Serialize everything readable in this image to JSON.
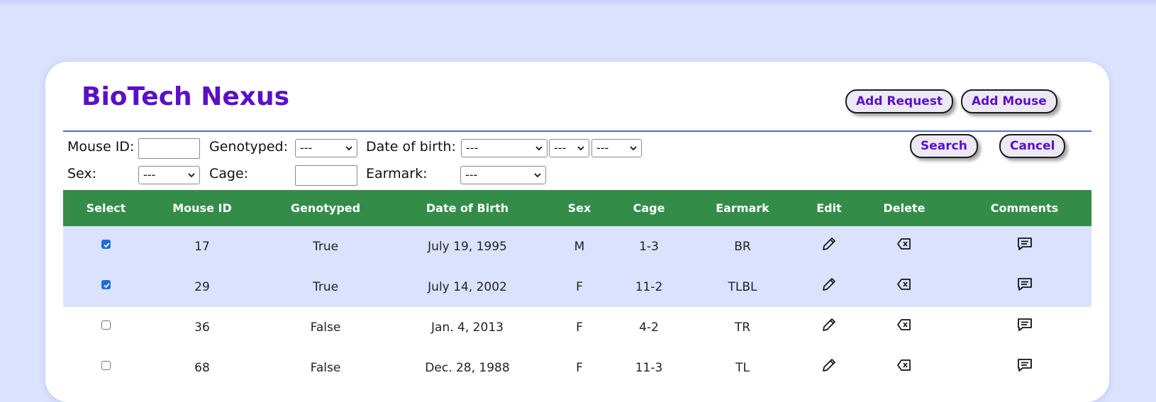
{
  "app": {
    "title": "BioTech Nexus"
  },
  "header": {
    "add_request": "Add Request",
    "add_mouse": "Add Mouse"
  },
  "filters": {
    "mouse_id_label": "Mouse ID:",
    "genotyped_label": "Genotyped:",
    "genotyped_value": "---",
    "dob_label": "Date of birth:",
    "dob_month_value": "---",
    "dob_day_value": "---",
    "dob_year_value": "---",
    "sex_label": "Sex:",
    "sex_value": "---",
    "cage_label": "Cage:",
    "earmark_label": "Earmark:",
    "earmark_value": "---",
    "search": "Search",
    "cancel": "Cancel"
  },
  "table": {
    "columns": [
      "Select",
      "Mouse ID",
      "Genotyped",
      "Date of Birth",
      "Sex",
      "Cage",
      "Earmark",
      "Edit",
      "Delete",
      "Comments"
    ],
    "rows": [
      {
        "selected": true,
        "id": "17",
        "genotyped": "True",
        "dob": "July 19, 1995",
        "sex": "M",
        "cage": "1-3",
        "earmark": "BR"
      },
      {
        "selected": true,
        "id": "29",
        "genotyped": "True",
        "dob": "July 14, 2002",
        "sex": "F",
        "cage": "11-2",
        "earmark": "TLBL"
      },
      {
        "selected": false,
        "id": "36",
        "genotyped": "False",
        "dob": "Jan. 4, 2013",
        "sex": "F",
        "cage": "4-2",
        "earmark": "TR"
      },
      {
        "selected": false,
        "id": "68",
        "genotyped": "False",
        "dob": "Dec. 28, 1988",
        "sex": "F",
        "cage": "11-3",
        "earmark": "TL"
      }
    ],
    "icons": {
      "edit": "pencil-icon",
      "delete": "backspace-x-icon",
      "comments": "comment-icon"
    }
  },
  "colors": {
    "page_bg": "#dbe2fd",
    "brand": "#5a10c8",
    "header_green": "#338d48",
    "selected_row": "#dbe2fd",
    "divider": "#5a67c8"
  }
}
